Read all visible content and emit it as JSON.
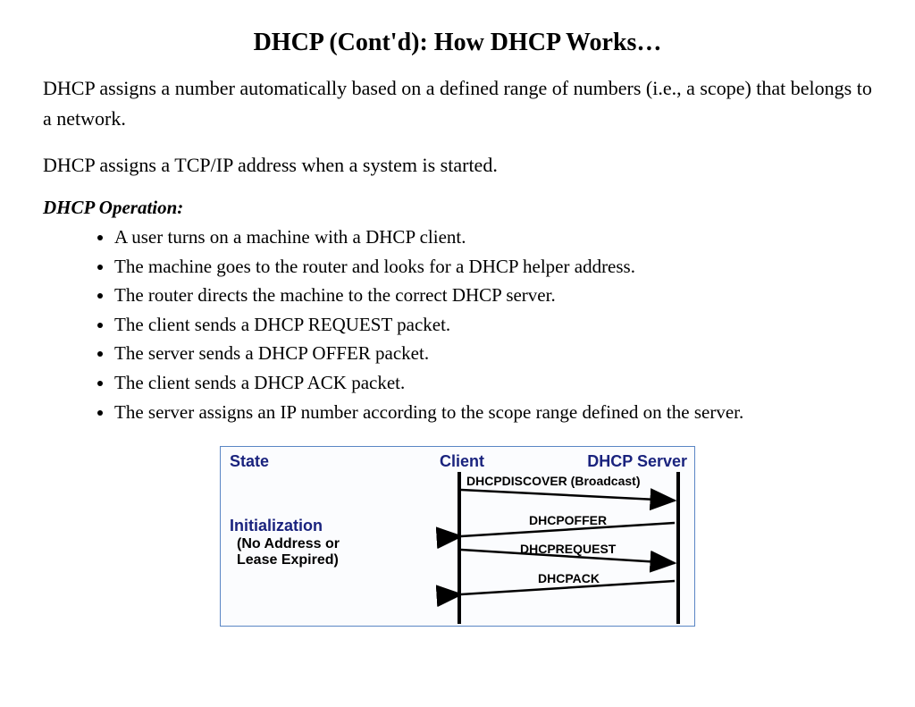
{
  "title": "DHCP (Cont'd): How DHCP Works…",
  "para1": "DHCP assigns a number automatically based on a defined range of numbers (i.e., a scope) that belongs to a network.",
  "para2": "DHCP assigns a TCP/IP address when a system is started.",
  "subhead": "DHCP Operation:",
  "bullets": [
    "A user turns on a machine with a DHCP client.",
    "The machine goes to the router and looks for a DHCP helper address.",
    "The router directs the machine to the correct DHCP server.",
    "The client sends a DHCP REQUEST packet.",
    "The server sends a DHCP OFFER packet.",
    "The client sends a DHCP ACK packet.",
    "The server assigns an IP number according to the scope range defined on the server."
  ],
  "diagram": {
    "state_label": "State",
    "client_label": "Client",
    "server_label": "DHCP Server",
    "init_label": "Initialization",
    "init_sub1": "(No Address or",
    "init_sub2": "Lease Expired)",
    "messages": [
      "DHCPDISCOVER (Broadcast)",
      "DHCPOFFER",
      "DHCPREQUEST",
      "DHCPACK"
    ]
  }
}
